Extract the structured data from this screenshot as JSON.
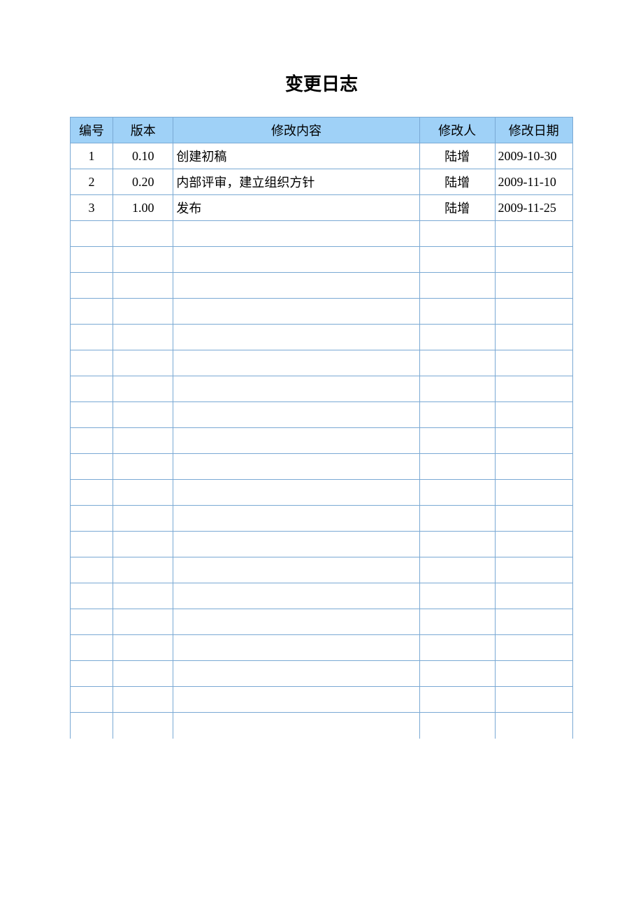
{
  "title": "变更日志",
  "headers": {
    "id": "编号",
    "version": "版本",
    "content": "修改内容",
    "author": "修改人",
    "date": "修改日期"
  },
  "rows": [
    {
      "id": "1",
      "version": "0.10",
      "content": "创建初稿",
      "author": "陆增",
      "date": "2009-10-30"
    },
    {
      "id": "2",
      "version": "0.20",
      "content": "内部评审，建立组织方针",
      "author": "陆增",
      "date": "2009-11-10"
    },
    {
      "id": "3",
      "version": "1.00",
      "content": "发布",
      "author": "陆增",
      "date": "2009-11-25"
    },
    {
      "id": "",
      "version": "",
      "content": "",
      "author": "",
      "date": ""
    },
    {
      "id": "",
      "version": "",
      "content": "",
      "author": "",
      "date": ""
    },
    {
      "id": "",
      "version": "",
      "content": "",
      "author": "",
      "date": ""
    },
    {
      "id": "",
      "version": "",
      "content": "",
      "author": "",
      "date": ""
    },
    {
      "id": "",
      "version": "",
      "content": "",
      "author": "",
      "date": ""
    },
    {
      "id": "",
      "version": "",
      "content": "",
      "author": "",
      "date": ""
    },
    {
      "id": "",
      "version": "",
      "content": "",
      "author": "",
      "date": ""
    },
    {
      "id": "",
      "version": "",
      "content": "",
      "author": "",
      "date": ""
    },
    {
      "id": "",
      "version": "",
      "content": "",
      "author": "",
      "date": ""
    },
    {
      "id": "",
      "version": "",
      "content": "",
      "author": "",
      "date": ""
    },
    {
      "id": "",
      "version": "",
      "content": "",
      "author": "",
      "date": ""
    },
    {
      "id": "",
      "version": "",
      "content": "",
      "author": "",
      "date": ""
    },
    {
      "id": "",
      "version": "",
      "content": "",
      "author": "",
      "date": ""
    },
    {
      "id": "",
      "version": "",
      "content": "",
      "author": "",
      "date": ""
    },
    {
      "id": "",
      "version": "",
      "content": "",
      "author": "",
      "date": ""
    },
    {
      "id": "",
      "version": "",
      "content": "",
      "author": "",
      "date": ""
    },
    {
      "id": "",
      "version": "",
      "content": "",
      "author": "",
      "date": ""
    },
    {
      "id": "",
      "version": "",
      "content": "",
      "author": "",
      "date": ""
    },
    {
      "id": "",
      "version": "",
      "content": "",
      "author": "",
      "date": ""
    },
    {
      "id": "",
      "version": "",
      "content": "",
      "author": "",
      "date": ""
    }
  ]
}
